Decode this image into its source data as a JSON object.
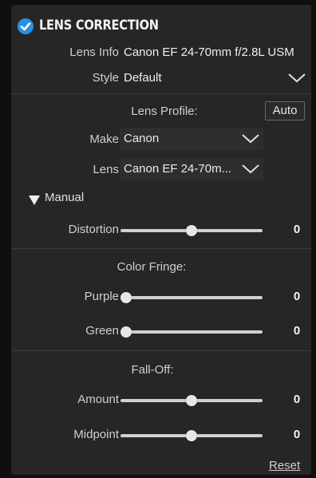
{
  "header": {
    "title": "LENS CORRECTION",
    "enabled": true
  },
  "lens_info": {
    "label": "Lens Info",
    "value": "Canon EF 24-70mm f/2.8L USM"
  },
  "style": {
    "label": "Style",
    "value": "Default"
  },
  "lens_profile": {
    "heading": "Lens Profile:",
    "auto_label": "Auto",
    "make": {
      "label": "Make",
      "value": "Canon"
    },
    "lens": {
      "label": "Lens",
      "value": "Canon EF 24-70m..."
    }
  },
  "manual": {
    "label": "Manual",
    "expanded": true,
    "distortion": {
      "label": "Distortion",
      "value": "0",
      "position": 0.5
    }
  },
  "color_fringe": {
    "heading": "Color Fringe:",
    "purple": {
      "label": "Purple",
      "value": "0",
      "position": 0.0
    },
    "green": {
      "label": "Green",
      "value": "0",
      "position": 0.0
    }
  },
  "fall_off": {
    "heading": "Fall-Off:",
    "amount": {
      "label": "Amount",
      "value": "0",
      "position": 0.5
    },
    "midpoint": {
      "label": "Midpoint",
      "value": "0",
      "position": 0.5
    }
  },
  "footer": {
    "reset_label": "Reset"
  },
  "colors": {
    "accent": "#2d8fe0",
    "panel": "#262626",
    "background": "#0f0f0f"
  }
}
